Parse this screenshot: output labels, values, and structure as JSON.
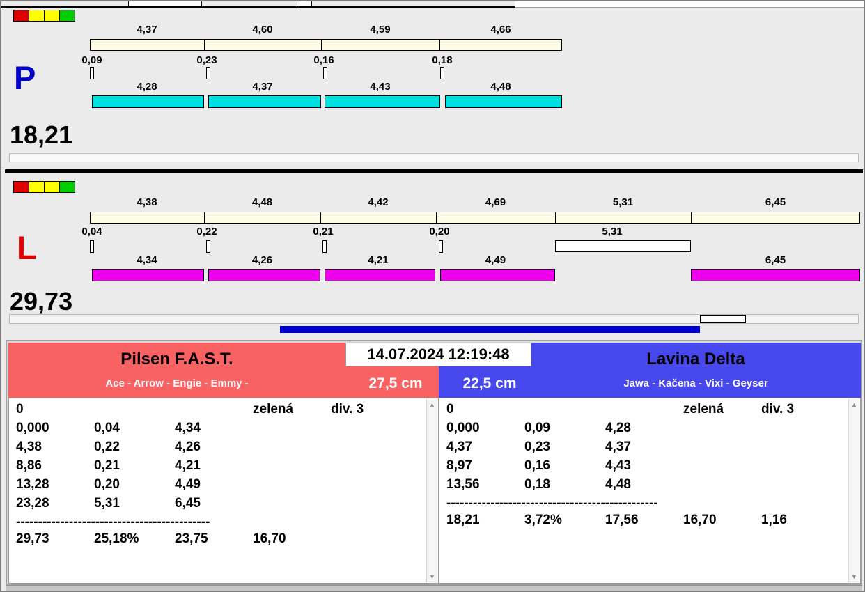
{
  "colors": {
    "cream_bar": "#fcfbe4",
    "cyan_bar": "#00e0e0",
    "magenta_bar": "#ee00ee",
    "white_bar": "#ffffff",
    "progress_bar": "#0000cc",
    "p_letter": "#0000cc",
    "l_letter": "#dd0000",
    "left_header": "#f96262",
    "right_header": "#4747ee",
    "indicator_red": "#dd0000",
    "indicator_yellow": "#ffff00",
    "indicator_green": "#00cc00"
  },
  "p_panel": {
    "letter": "P",
    "total": "18,21",
    "top_values": [
      "4,37",
      "4,60",
      "4,59",
      "4,66"
    ],
    "change_values": [
      "0,09",
      "0,23",
      "0,16",
      "0,18"
    ],
    "bottom_values": [
      "4,28",
      "4,37",
      "4,43",
      "4,48"
    ]
  },
  "l_panel": {
    "letter": "L",
    "total": "29,73",
    "top_values": [
      "4,38",
      "4,48",
      "4,42",
      "4,69",
      "5,31",
      "6,45"
    ],
    "change_values": [
      "0,04",
      "0,22",
      "0,21",
      "0,20"
    ],
    "mid_value": "5,31",
    "bottom_values": [
      "4,34",
      "4,26",
      "4,21",
      "4,49",
      "6,45"
    ]
  },
  "datetime": "14.07.2024 12:19:48",
  "left_team": {
    "name": "Pilsen F.A.S.T.",
    "members": "Ace - Arrow - Engie - Emmy -",
    "height": "27,5 cm"
  },
  "right_team": {
    "name": "Lavina Delta",
    "members": "Jawa - Kačena - Vixi - Geyser",
    "height": "22,5 cm"
  },
  "left_table": {
    "rows": [
      [
        "0",
        "",
        "",
        "zelená",
        "div. 3"
      ],
      [
        "0,000",
        "0,04",
        "4,34"
      ],
      [
        "4,38",
        "0,22",
        "4,26"
      ],
      [
        "8,86",
        "0,21",
        "4,21"
      ],
      [
        "13,28",
        "0,20",
        "4,49"
      ],
      [
        "23,28",
        "5,31",
        "6,45"
      ],
      [
        "29,73",
        "25,18%",
        "23,75",
        "16,70"
      ]
    ],
    "dashes": "--------------------------------------------"
  },
  "right_table": {
    "rows": [
      [
        "0",
        "",
        "",
        "zelená",
        "div. 3"
      ],
      [
        "0,000",
        "0,09",
        "4,28"
      ],
      [
        "4,37",
        "0,23",
        "4,37"
      ],
      [
        "8,97",
        "0,16",
        "4,43"
      ],
      [
        "13,56",
        "0,18",
        "4,48"
      ],
      [
        "18,21",
        "3,72%",
        "17,56",
        "16,70",
        "1,16"
      ]
    ],
    "dashes": "------------------------------------------------"
  },
  "icons": {
    "scroll_up": "▲",
    "scroll_down": "▼"
  }
}
